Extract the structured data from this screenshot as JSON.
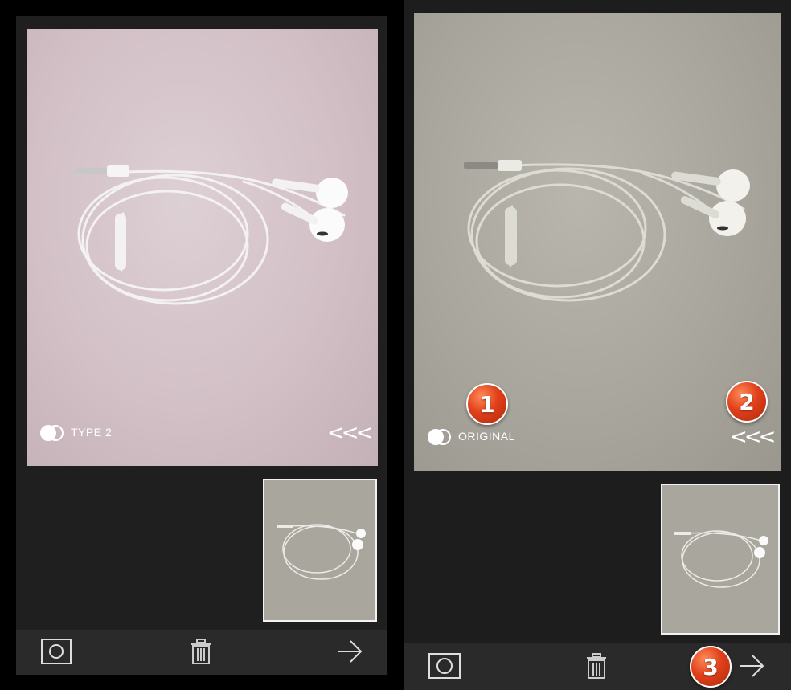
{
  "left_screen": {
    "filter_label": "TYPE 2",
    "filter_icon": "overlap-circles-icon",
    "swipe_hint": "<<<",
    "toolbar": {
      "camera_icon": "camera-icon",
      "trash_icon": "trash-icon",
      "next_icon": "arrow-right-icon"
    }
  },
  "right_screen": {
    "filter_label": "ORIGINAL",
    "filter_icon": "overlap-circles-icon",
    "swipe_hint": "<<<",
    "toolbar": {
      "camera_icon": "camera-icon",
      "trash_icon": "trash-icon",
      "next_icon": "arrow-right-icon"
    },
    "callouts": [
      "1",
      "2",
      "3"
    ]
  },
  "colors": {
    "badge": "#e0401a",
    "toolbar_bg": "#2a2a2a",
    "screen_bg": "#1f1f1f"
  }
}
